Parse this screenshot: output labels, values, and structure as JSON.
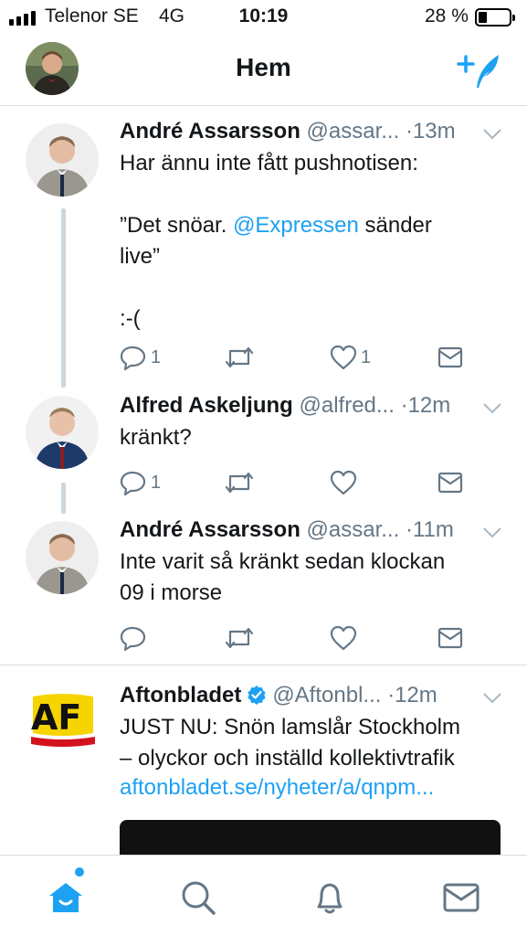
{
  "status": {
    "carrier": "Telenor SE",
    "network": "4G",
    "time": "10:19",
    "battery": "28 %",
    "battery_level": 0.28
  },
  "nav": {
    "title": "Hem"
  },
  "colors": {
    "accent": "#1da1f2",
    "secondary": "#657786",
    "thread_line": "#ccd6dd"
  },
  "tweets": [
    {
      "name": "André Assarsson",
      "handle": "@assar...",
      "sep": "·",
      "time": "13m",
      "text_pre": "Har ännu inte fått pushnotisen:\n\n”Det snöar. ",
      "mention": "@Expressen",
      "text_post": " sänder\nlive”\n\n:-(",
      "reply_count": "1",
      "retweet_count": "",
      "like_count": "1"
    },
    {
      "name": "Alfred Askeljung",
      "handle": "@alfred...",
      "sep": "·",
      "time": "12m",
      "text": "kränkt?",
      "reply_count": "1",
      "retweet_count": "",
      "like_count": ""
    },
    {
      "name": "André Assarsson",
      "handle": "@assar...",
      "sep": "·",
      "time": "11m",
      "text": "Inte varit så kränkt sedan klockan\n09 i morse",
      "reply_count": "",
      "retweet_count": "",
      "like_count": ""
    },
    {
      "name": "Aftonbladet",
      "handle": "@Aftonbl...",
      "sep": "·",
      "time": "12m",
      "text": "JUST NU: Snön lamslår Stockholm\n– olyckor och inställd kollektivtrafik",
      "link": "aftonbladet.se/nyheter/a/qnpm...",
      "logo_text": "AF"
    }
  ],
  "tabs": [
    "home-icon",
    "search-icon",
    "notifications-icon",
    "messages-icon"
  ]
}
